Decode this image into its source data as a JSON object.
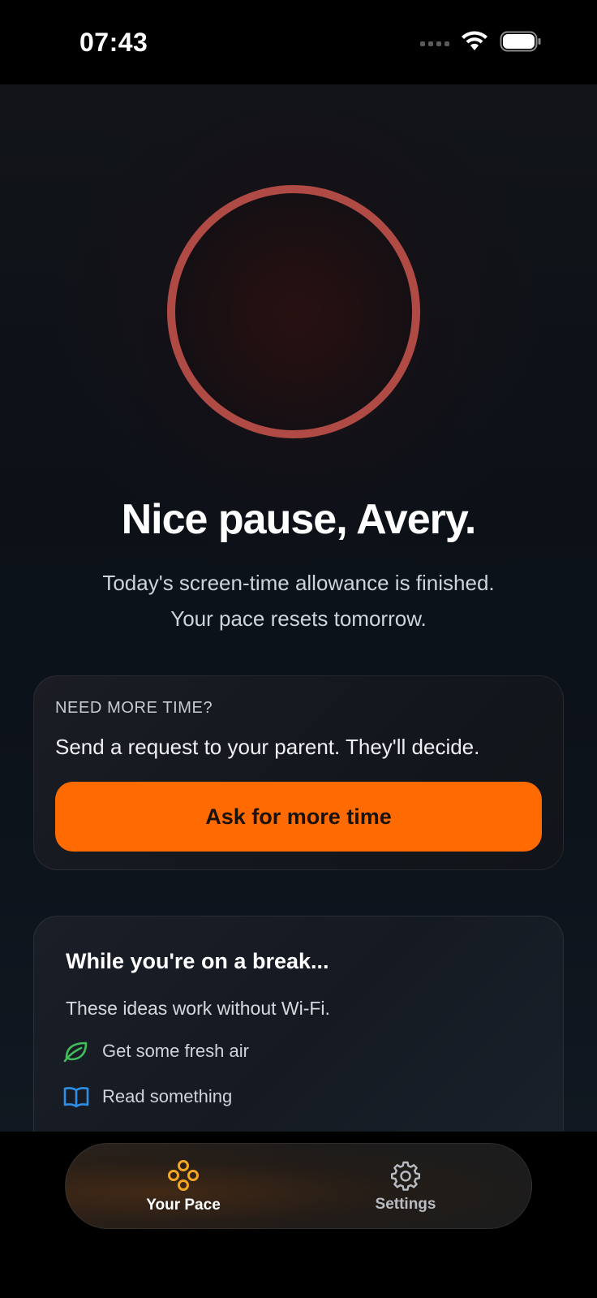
{
  "status_bar": {
    "time": "07:43"
  },
  "hero": {
    "headline": "Nice pause, Avery.",
    "subtext": "Today's screen-time allowance is finished. Your pace resets tomorrow.",
    "ring_color": "#b04a45"
  },
  "request_card": {
    "eyebrow": "NEED MORE TIME?",
    "text": "Send a request to your parent. They'll decide.",
    "button_label": "Ask for more time",
    "accent": "#ff6b00"
  },
  "break_card": {
    "title": "While you're on a break...",
    "subtitle": "These ideas work without Wi-Fi.",
    "ideas": [
      {
        "icon": "leaf-icon",
        "label": "Get some fresh air",
        "color": "#3fbf5a"
      },
      {
        "icon": "book-icon",
        "label": "Read something",
        "color": "#2f8fe8"
      }
    ]
  },
  "tab_bar": {
    "tabs": [
      {
        "icon": "pace-icon",
        "label": "Your Pace",
        "active": true,
        "color": "#f5a623"
      },
      {
        "icon": "gear-icon",
        "label": "Settings",
        "active": false,
        "color": "#b9bcc2"
      }
    ]
  }
}
